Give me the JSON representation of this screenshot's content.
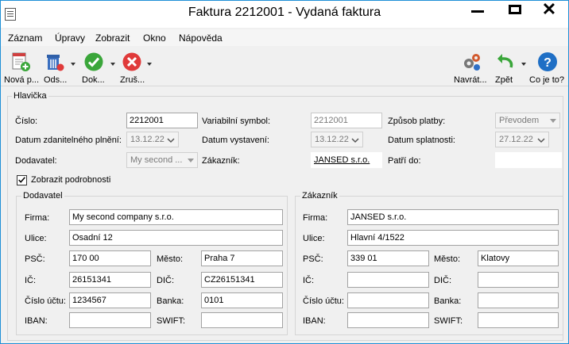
{
  "window": {
    "title": "Faktura 2212001 - Vydaná faktura",
    "min_icon": "minimize-icon",
    "max_icon": "maximize-icon",
    "close_symbol": "✕"
  },
  "menu": [
    "Záznam",
    "Úpravy",
    "Zobrazit",
    "Okno",
    "Nápověda"
  ],
  "toolbar": {
    "new": "Nová p...",
    "send": "Ods...",
    "doc": "Dok...",
    "cancel": "Zruš...",
    "return": "Navrát...",
    "back": "Zpět",
    "help": "Co je to?"
  },
  "header": {
    "group_title": "Hlavička",
    "cislo_label": "Číslo:",
    "cislo_value": "2212001",
    "datum_zdan_label": "Datum zdanitelného plnění:",
    "datum_zdan_value": "13.12.22",
    "dodavatel_label": "Dodavatel:",
    "dodavatel_value": "My second ...",
    "varsym_label": "Variabilní symbol:",
    "varsym_value": "2212001",
    "datum_vyst_label": "Datum vystavení:",
    "datum_vyst_value": "13.12.22",
    "zakaznik_label": "Zákazník:",
    "zakaznik_value": "JANSED s.r.o.",
    "zpusob_label": "Způsob platby:",
    "zpusob_value": "Převodem",
    "splatnost_label": "Datum splatnosti:",
    "splatnost_value": "27.12.22",
    "patri_label": "Patří do:",
    "patri_value": "",
    "zobrazit_label": "Zobrazit podrobnosti",
    "zobrazit_checked": true
  },
  "supplier": {
    "group_title": "Dodavatel",
    "firma_label": "Firma:",
    "firma": "My second company s.r.o.",
    "ulice_label": "Ulice:",
    "ulice": "Osadní 12",
    "psc_label": "PSČ:",
    "psc": "170 00",
    "mesto_label": "Město:",
    "mesto": "Praha 7",
    "ic_label": "IČ:",
    "ic": "26151341",
    "dic_label": "DIČ:",
    "dic": "CZ26151341",
    "ucet_label": "Číslo účtu:",
    "ucet": "1234567",
    "banka_label": "Banka:",
    "banka": "0101",
    "iban_label": "IBAN:",
    "iban": "",
    "swift_label": "SWIFT:",
    "swift": ""
  },
  "customer": {
    "group_title": "Zákazník",
    "firma_label": "Firma:",
    "firma": "JANSED s.r.o.",
    "ulice_label": "Ulice:",
    "ulice": "Hlavní 4/1522",
    "psc_label": "PSČ:",
    "psc": "339 01",
    "mesto_label": "Město:",
    "mesto": "Klatovy",
    "ic_label": "IČ:",
    "ic": "",
    "dic_label": "DIČ:",
    "dic": "",
    "ucet_label": "Číslo účtu:",
    "ucet": "",
    "banka_label": "Banka:",
    "banka": "",
    "iban_label": "IBAN:",
    "iban": "",
    "swift_label": "SWIFT:",
    "swift": ""
  },
  "colors": {
    "accent_border": "#1e8fd6",
    "green": "#3aa63a",
    "red": "#e03a3a",
    "help_blue": "#1f6fc5"
  }
}
